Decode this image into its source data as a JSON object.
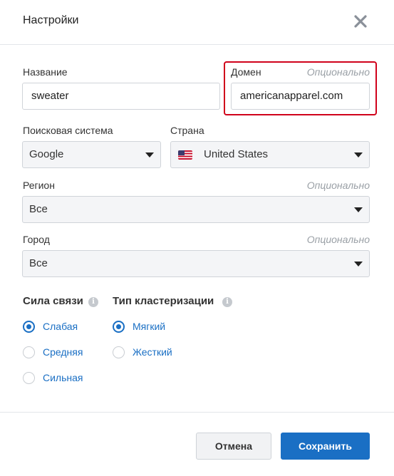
{
  "dialog": {
    "title": "Настройки",
    "close_icon": "close-icon"
  },
  "fields": {
    "name": {
      "label": "Название",
      "value": "sweater"
    },
    "domain": {
      "label": "Домен",
      "optional": "Опционально",
      "value": "americanapparel.com"
    },
    "search_engine": {
      "label": "Поисковая система",
      "value": "Google"
    },
    "country": {
      "label": "Страна",
      "value": "United States",
      "flag_icon": "us-flag-icon"
    },
    "region": {
      "label": "Регион",
      "optional": "Опционально",
      "value": "Все"
    },
    "city": {
      "label": "Город",
      "optional": "Опционально",
      "value": "Все"
    }
  },
  "link_strength": {
    "label": "Сила связи",
    "options": [
      {
        "label": "Слабая",
        "selected": true
      },
      {
        "label": "Средняя",
        "selected": false
      },
      {
        "label": "Сильная",
        "selected": false
      }
    ]
  },
  "clustering": {
    "label": "Тип кластеризации",
    "options": [
      {
        "label": "Мягкий",
        "selected": true
      },
      {
        "label": "Жесткий",
        "selected": false
      }
    ]
  },
  "buttons": {
    "cancel": "Отмена",
    "save": "Сохранить"
  },
  "colors": {
    "accent": "#1a6fc4",
    "highlight": "#d0021b"
  }
}
